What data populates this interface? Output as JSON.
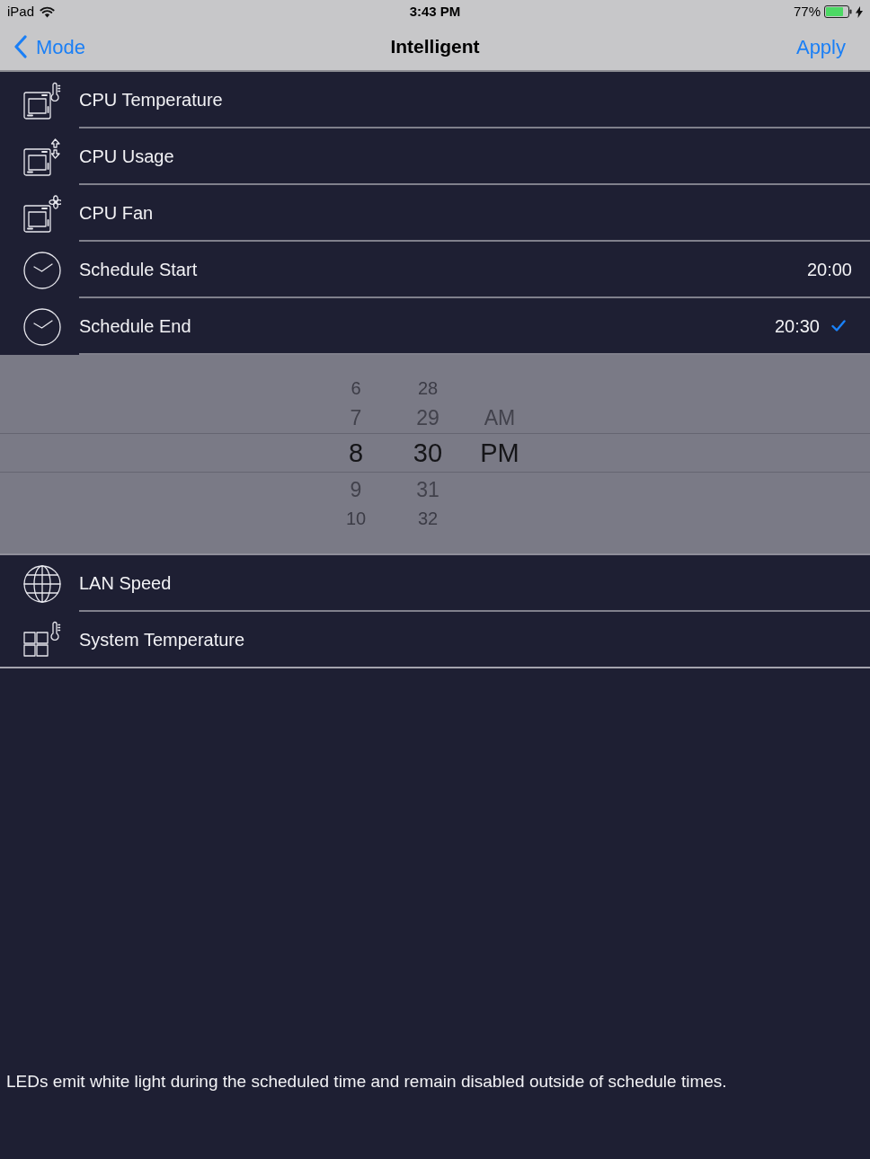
{
  "status_bar": {
    "device": "iPad",
    "time": "3:43 PM",
    "battery": "77%",
    "charging": true
  },
  "nav_bar": {
    "back": "Mode",
    "title": "Intelligent",
    "action": "Apply"
  },
  "rows": [
    {
      "kind": "chip-thermometer",
      "label": "CPU Temperature",
      "selected": false
    },
    {
      "kind": "chip-arrows",
      "label": "CPU Usage",
      "selected": false
    },
    {
      "kind": "chip-fan",
      "label": "CPU Fan",
      "selected": false
    },
    {
      "kind": "clock",
      "label": "Schedule Start",
      "value": "20:00",
      "selected": false
    },
    {
      "kind": "clock",
      "label": "Schedule End",
      "value": "20:30",
      "selected": true,
      "picker": {
        "columns": [
          {
            "items": [
              {
                "label": "6",
                "selected": false
              },
              {
                "label": "7",
                "selected": false
              },
              {
                "label": "8",
                "selected": true
              },
              {
                "label": "9",
                "selected": false
              },
              {
                "label": "10",
                "selected": false
              }
            ]
          },
          {
            "items": [
              {
                "label": "28",
                "selected": false
              },
              {
                "label": "29",
                "selected": false
              },
              {
                "label": "30",
                "selected": true
              },
              {
                "label": "31",
                "selected": false
              },
              {
                "label": "32",
                "selected": false
              }
            ]
          },
          {
            "items": [
              {
                "label": "AM",
                "selected": false
              },
              {
                "label": "PM",
                "selected": true
              }
            ]
          }
        ]
      }
    },
    {
      "kind": "globe",
      "label": "LAN Speed",
      "selected": false
    },
    {
      "kind": "grid-thermometer",
      "label": "System Temperature",
      "selected": false
    }
  ],
  "note": "LEDs emit white light during the scheduled time and remain disabled outside of schedule times."
}
